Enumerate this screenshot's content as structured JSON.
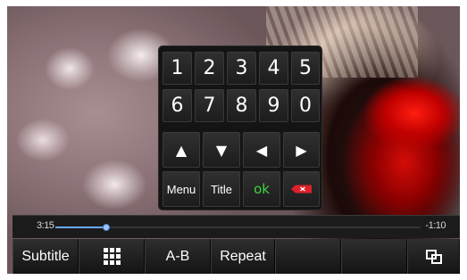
{
  "keypad": {
    "digits": [
      "1",
      "2",
      "3",
      "4",
      "5",
      "6",
      "7",
      "8",
      "9",
      "0"
    ],
    "arrows": {
      "up": "▲",
      "down": "▼",
      "left": "◀",
      "right": "▶"
    },
    "menu_label": "Menu",
    "title_label": "Title",
    "ok_label": "ok",
    "delete_icon": "delete-icon",
    "ok_color": "#3fd33f",
    "delete_color": "#e0202a"
  },
  "playback": {
    "elapsed": "3:15",
    "remaining": "-1:10",
    "progress_fraction": 0.14,
    "progress_color": "#6aa8ff"
  },
  "toolbar": {
    "subtitle_label": "Subtitle",
    "grid_icon": "grid-icon",
    "ab_label": "A-B",
    "repeat_label": "Repeat",
    "window_icon": "window-icon"
  }
}
